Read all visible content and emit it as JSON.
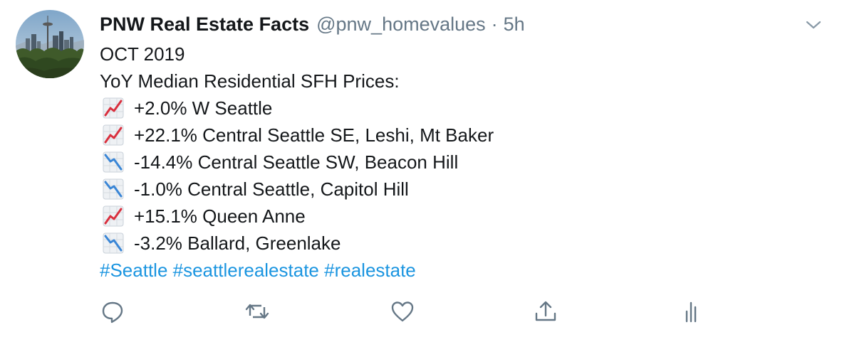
{
  "author": {
    "display_name": "PNW Real Estate Facts",
    "handle": "@pnw_homevalues",
    "separator": "·",
    "time": "5h",
    "avatar_icon": "seattle-skyline-avatar"
  },
  "tweet": {
    "lines": [
      {
        "text": "OCT 2019"
      },
      {
        "text": "YoY Median Residential SFH Prices:"
      },
      {
        "icon": "chart-increasing-emoji",
        "text": "+2.0% W Seattle"
      },
      {
        "icon": "chart-increasing-emoji",
        "text": "+22.1% Central Seattle SE, Leshi, Mt Baker"
      },
      {
        "icon": "chart-decreasing-emoji",
        "text": "-14.4% Central Seattle SW, Beacon Hill"
      },
      {
        "icon": "chart-decreasing-emoji",
        "text": "-1.0% Central Seattle, Capitol Hill"
      },
      {
        "icon": "chart-increasing-emoji",
        "text": "+15.1% Queen Anne"
      },
      {
        "icon": "chart-decreasing-emoji",
        "text": "-3.2% Ballard, Greenlake"
      }
    ],
    "hashtags": [
      "#Seattle",
      "#seattlerealestate",
      "#realestate"
    ]
  },
  "actions": [
    "reply-icon",
    "retweet-icon",
    "like-icon",
    "share-icon",
    "analytics-icon"
  ],
  "colors": {
    "link": "#1b95e0",
    "secondary": "#657786",
    "text": "#14171a",
    "chart_up": "#d9303e",
    "chart_down": "#3a86d6"
  }
}
